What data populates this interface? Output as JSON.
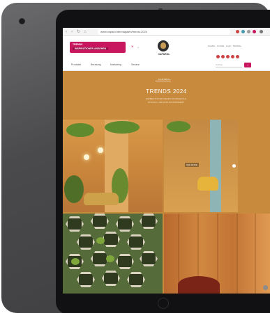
{
  "browser": {
    "url": "www.caparol.de/magazin/trends-2024",
    "back_icon": "arrow-left-icon",
    "forward_icon": "arrow-right-icon",
    "reload_icon": "reload-icon"
  },
  "header": {
    "promo_line1": "TRENDS",
    "promo_line2": "INSPIRATIONEN ANSEHEN",
    "promo_close": "×",
    "logo_text": "CAPAROL",
    "util_text": "Händler · Kontakt · Login · Merkliste"
  },
  "nav": {
    "items": [
      "Produkte",
      "Beratung",
      "Marketing",
      "Service"
    ],
    "search_placeholder": "Suchen",
    "search_button": "›"
  },
  "hero": {
    "brand_tag": "CAPAROL",
    "title": "TRENDS 2024",
    "subtitle_lines": [
      "FARBEN FÜR EIN NEUES WOHNGEFÜHL",
      "STILVOLL UND ZEITLOS INSPIRIERT"
    ]
  },
  "gallery": {
    "overlay_caption": "SEE MORE"
  },
  "colors": {
    "brand": "#c8175f",
    "hero_bg": "#c88a3c",
    "device": "#4a4a4c"
  }
}
